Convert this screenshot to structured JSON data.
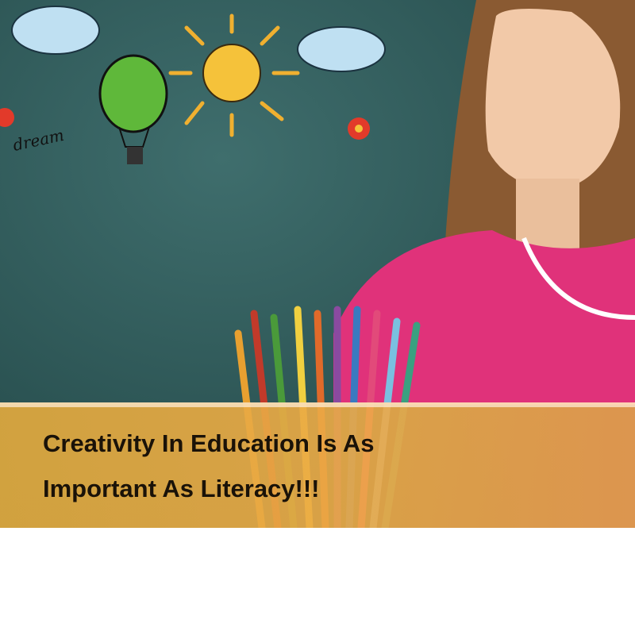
{
  "headline": {
    "line1": "Creativity In Education Is As",
    "line2": "Important As Literacy!!!"
  },
  "doodle_text": "dream",
  "colors": {
    "chalkboard": "#2e5b5c",
    "shirt": "#e0327a",
    "banner": "#dea83e",
    "text": "#1a1208"
  }
}
